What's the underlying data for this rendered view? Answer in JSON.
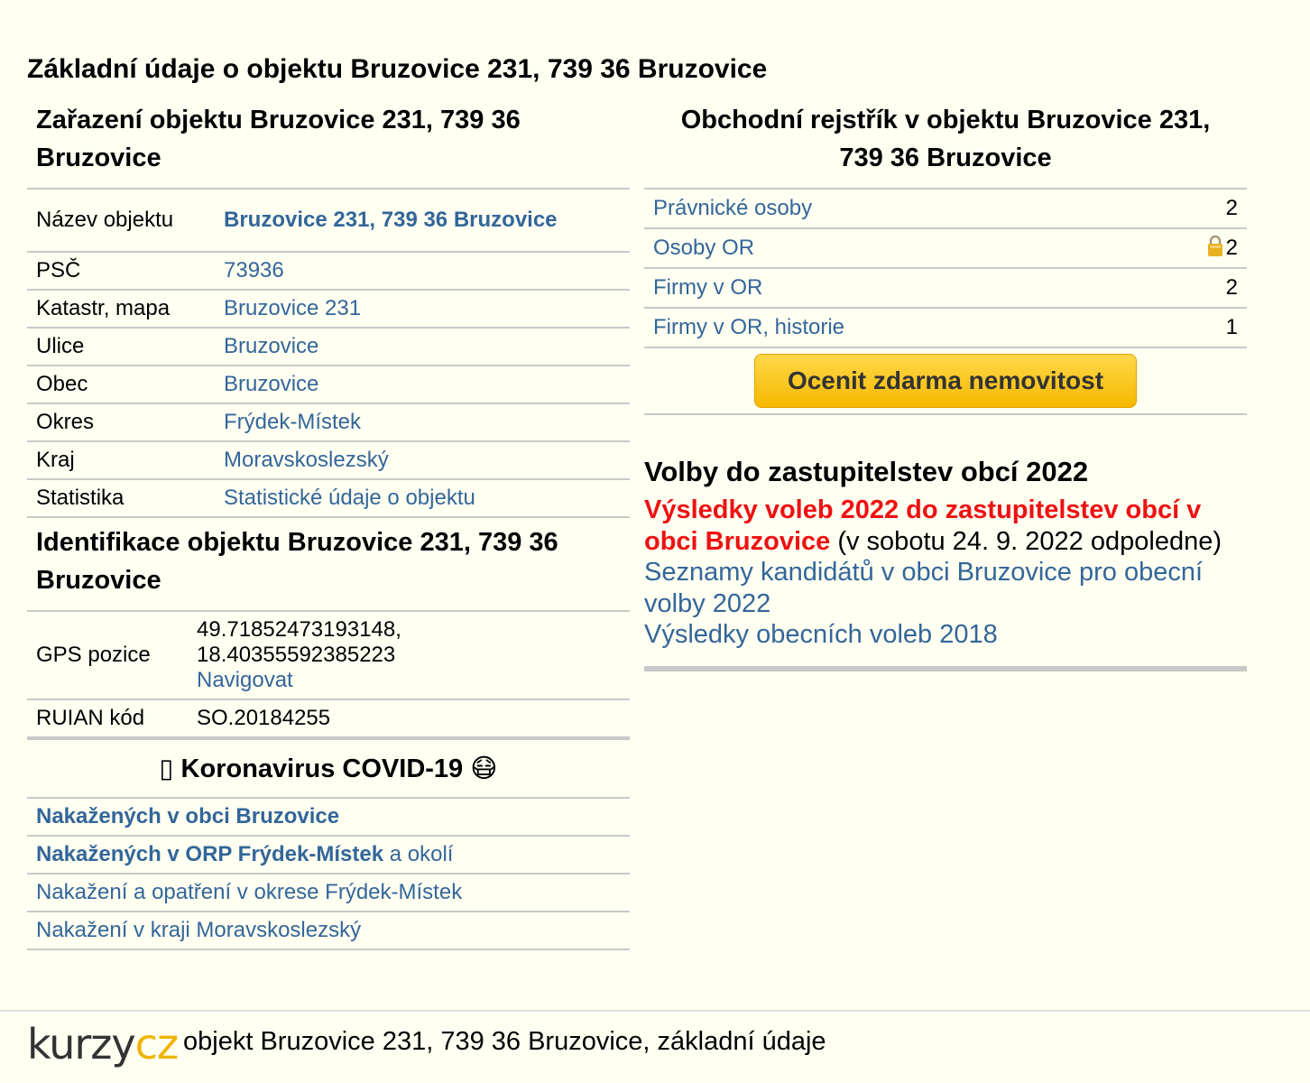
{
  "page_title": "Základní údaje o objektu Bruzovice 231, 739 36 Bruzovice",
  "zarazeni": {
    "heading": "Zařazení objektu Bruzovice 231, 739 36 Bruzovice",
    "rows": [
      {
        "key": "Název objektu",
        "value": "Bruzovice 231, 739 36 Bruzovice"
      },
      {
        "key": "PSČ",
        "value": "73936"
      },
      {
        "key": "Katastr, mapa",
        "value": "Bruzovice 231"
      },
      {
        "key": "Ulice",
        "value": "Bruzovice"
      },
      {
        "key": "Obec",
        "value": "Bruzovice"
      },
      {
        "key": "Okres",
        "value": "Frýdek-Místek"
      },
      {
        "key": "Kraj",
        "value": "Moravskoslezský"
      },
      {
        "key": "Statistika",
        "value": "Statistické údaje o objektu"
      }
    ]
  },
  "identifikace": {
    "heading": "Identifikace objektu Bruzovice 231, 739 36 Bruzovice",
    "gps_label": "GPS pozice",
    "gps_lat": "49.71852473193148,",
    "gps_lon": "18.40355592385223",
    "navigate_label": "Navigovat",
    "ruian_label": "RUIAN kód",
    "ruian_value": "SO.20184255"
  },
  "covid": {
    "heading": "Koronavirus COVID-19",
    "box_glyph": "▯",
    "mask_glyph": "😷",
    "items": [
      {
        "link": "Nakažených v obci Bruzovice",
        "suffix": ""
      },
      {
        "link": "Nakažených v ORP Frýdek-Místek",
        "suffix": "a okolí"
      },
      {
        "link": "Nakažení a opatření v okrese Frýdek-Místek",
        "suffix": ""
      },
      {
        "link": "Nakažení v kraji Moravskoslezský",
        "suffix": ""
      }
    ]
  },
  "rejstrik": {
    "heading": "Obchodní rejstřík v objektu Bruzovice 231, 739 36 Bruzovice",
    "rows": [
      {
        "label": "Právnické osoby",
        "count": "2",
        "lock": false
      },
      {
        "label": "Osoby OR",
        "count": "2",
        "lock": true
      },
      {
        "label": "Firmy v OR",
        "count": "2",
        "lock": false
      },
      {
        "label": "Firmy v OR, historie",
        "count": "1",
        "lock": false
      }
    ],
    "button_label": "Ocenit zdarma nemovitost",
    "lock_icon": "lock-icon"
  },
  "volby": {
    "heading": "Volby do zastupitelstev obcí 2022",
    "result_link": "Výsledky voleb 2022 do zastupitelstev obcí v obci Bruzovice",
    "result_note": "(v sobotu 24. 9. 2022 odpoledne)",
    "candidates_link": "Seznamy kandidátů v obci Bruzovice pro obecní volby 2022",
    "results_2018_link": "Výsledky obecních voleb 2018",
    "red_color": "#ee1111"
  },
  "footer": {
    "logo_part1": "kurzy",
    "logo_part2": "cz",
    "text": "objekt Bruzovice 231, 739 36 Bruzovice, základní údaje"
  }
}
